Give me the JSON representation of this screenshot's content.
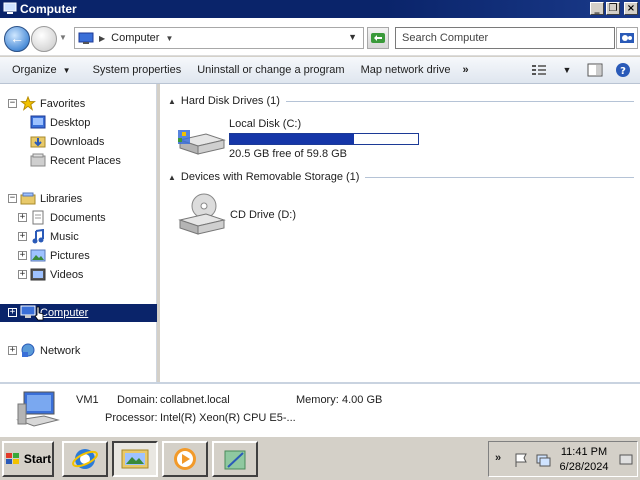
{
  "window": {
    "title": "Computer"
  },
  "address": {
    "crumb": "Computer",
    "search_placeholder": "Search Computer"
  },
  "toolbar": {
    "organize": "Organize",
    "system_properties": "System properties",
    "uninstall": "Uninstall or change a program",
    "map_drive": "Map network drive",
    "more": "»"
  },
  "nav": {
    "favorites": "Favorites",
    "desktop": "Desktop",
    "downloads": "Downloads",
    "recent_places": "Recent Places",
    "libraries": "Libraries",
    "documents": "Documents",
    "music": "Music",
    "pictures": "Pictures",
    "videos": "Videos",
    "computer": "Computer",
    "network": "Network"
  },
  "content": {
    "hdd_group": "Hard Disk Drives (1)",
    "removable_group": "Devices with Removable Storage (1)",
    "local_disk": {
      "name": "Local Disk (C:)",
      "free_text": "20.5 GB free of 59.8 GB",
      "used_fraction": 0.657
    },
    "cd_drive": {
      "name": "CD Drive (D:)"
    }
  },
  "details": {
    "computer_name": "VM1",
    "domain_label": "Domain:",
    "domain_value": "collabnet.local",
    "memory_label": "Memory:",
    "memory_value": "4.00 GB",
    "processor_label": "Processor:",
    "processor_value": "Intel(R) Xeon(R) CPU E5-..."
  },
  "taskbar": {
    "start": "Start",
    "time": "11:41 PM",
    "date": "6/28/2024",
    "tray_overflow": "»"
  },
  "colors": {
    "title_bar": "#0a246a",
    "selection": "#0a246a",
    "usage_bar": "#1536a8"
  }
}
